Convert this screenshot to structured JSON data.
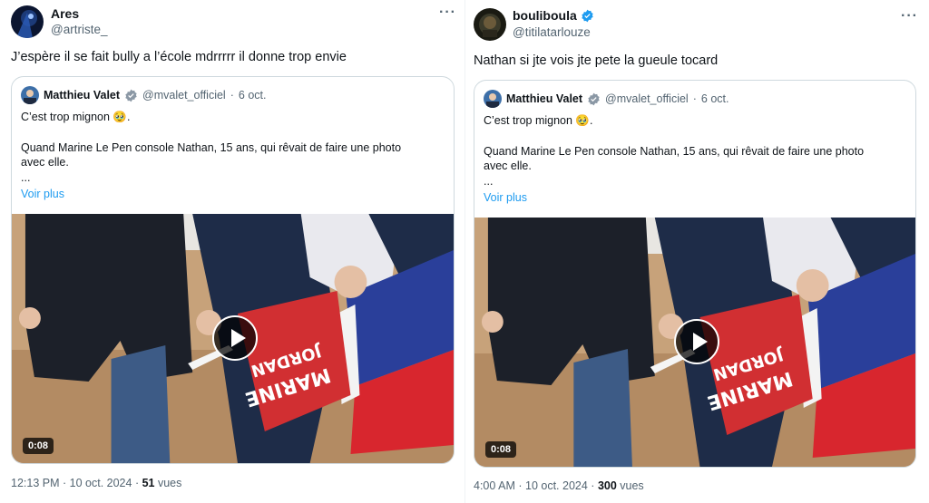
{
  "tweets": [
    {
      "display_name": "Ares",
      "handle": "@artriste_",
      "verified": false,
      "more": "···",
      "text": "J’espère il se fait bully a l’école mdrrrrr il donne trop envie",
      "quote": {
        "name": "Matthieu Valet",
        "handle": "@mvalet_officiel",
        "sep": "·",
        "date": "6 oct.",
        "line1": "C’est trop mignon 🥹.",
        "line2": "Quand Marine Le Pen console Nathan, 15 ans, qui rêvait de faire une photo",
        "line3": "avec elle.",
        "line4": "...",
        "see_more": "Voir plus",
        "video_duration": "0:08"
      },
      "time": "12:13 PM",
      "date": "10 oct. 2024",
      "views": "51",
      "views_label": "vues"
    },
    {
      "display_name": "bouliboula",
      "handle": "@titilatarlouze",
      "verified": true,
      "more": "···",
      "text": "Nathan si jte vois jte pete la gueule tocard",
      "quote": {
        "name": "Matthieu Valet",
        "handle": "@mvalet_officiel",
        "sep": "·",
        "date": "6 oct.",
        "line1": "C’est trop mignon 🥹.",
        "line2": "Quand Marine Le Pen console Nathan, 15 ans, qui rêvait de faire une photo",
        "line3": "avec elle.",
        "line4": "...",
        "see_more": "Voir plus",
        "video_duration": "0:08"
      },
      "time": "4:00 AM",
      "date": "10 oct. 2024",
      "views": "300",
      "views_label": "vues"
    }
  ],
  "colors": {
    "verified": "#1d9bf0",
    "link": "#1d9bf0",
    "muted": "#536471",
    "flag_blue": "#2a3f9a",
    "flag_red": "#d8262e",
    "sign_red": "#d12f32"
  },
  "video_sign_text": "MARINE JORDAN",
  "icons": [
    "more-icon",
    "verified-badge-icon",
    "play-icon"
  ]
}
